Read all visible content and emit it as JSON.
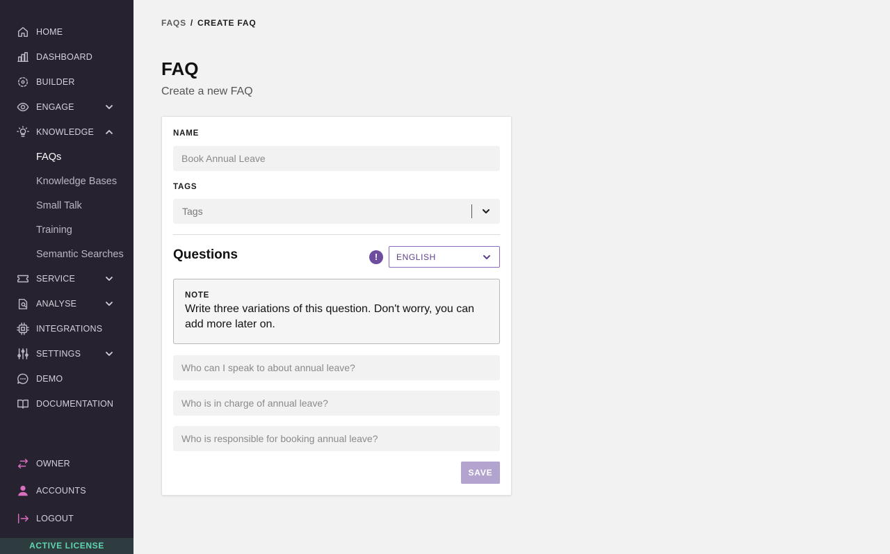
{
  "sidebar": {
    "nav": [
      {
        "label": "HOME",
        "icon": "home-icon"
      },
      {
        "label": "DASHBOARD",
        "icon": "bar-chart-icon"
      },
      {
        "label": "BUILDER",
        "icon": "builder-icon"
      },
      {
        "label": "ENGAGE",
        "icon": "eye-icon",
        "expandable": true
      },
      {
        "label": "KNOWLEDGE",
        "icon": "lightbulb-icon",
        "expanded": true
      }
    ],
    "knowledge_items": [
      "FAQs",
      "Knowledge Bases",
      "Small Talk",
      "Training",
      "Semantic Searches"
    ],
    "nav_lower": [
      {
        "label": "SERVICE",
        "icon": "ticket-icon"
      },
      {
        "label": "ANALYSE",
        "icon": "analyse-icon"
      },
      {
        "label": "INTEGRATIONS",
        "icon": "chip-icon"
      },
      {
        "label": "SETTINGS",
        "icon": "sliders-icon"
      },
      {
        "label": "DEMO",
        "icon": "chat-icon"
      },
      {
        "label": "DOCUMENTATION",
        "icon": "book-icon"
      }
    ],
    "account": [
      {
        "label": "OWNER",
        "icon": "swap-icon"
      },
      {
        "label": "ACCOUNTS",
        "icon": "user-icon"
      },
      {
        "label": "LOGOUT",
        "icon": "logout-icon"
      }
    ],
    "license": "ACTIVE LICENSE"
  },
  "breadcrumb": {
    "parent": "FAQS",
    "separator": "/",
    "current": "CREATE FAQ"
  },
  "page": {
    "title": "FAQ",
    "subtitle": "Create a new FAQ"
  },
  "form": {
    "name_label": "NAME",
    "name_placeholder": "Book Annual Leave",
    "tags_label": "TAGS",
    "tags_placeholder": "Tags",
    "questions_title": "Questions",
    "info_glyph": "!",
    "language": "ENGLISH",
    "note_label": "NOTE",
    "note_text": "Write three variations of this question. Don't worry, you can add more later on.",
    "question_placeholders": [
      "Who can I speak to about annual leave?",
      "Who is in charge of annual leave?",
      "Who is responsible for booking annual leave?"
    ],
    "save_label": "SAVE"
  },
  "colors": {
    "sidebar_bg": "#26222f",
    "accent_purple": "#6e4c9e",
    "save_disabled": "#b3a3cf",
    "license_text": "#5fd6b3",
    "account_icon": "#d86fbf"
  }
}
